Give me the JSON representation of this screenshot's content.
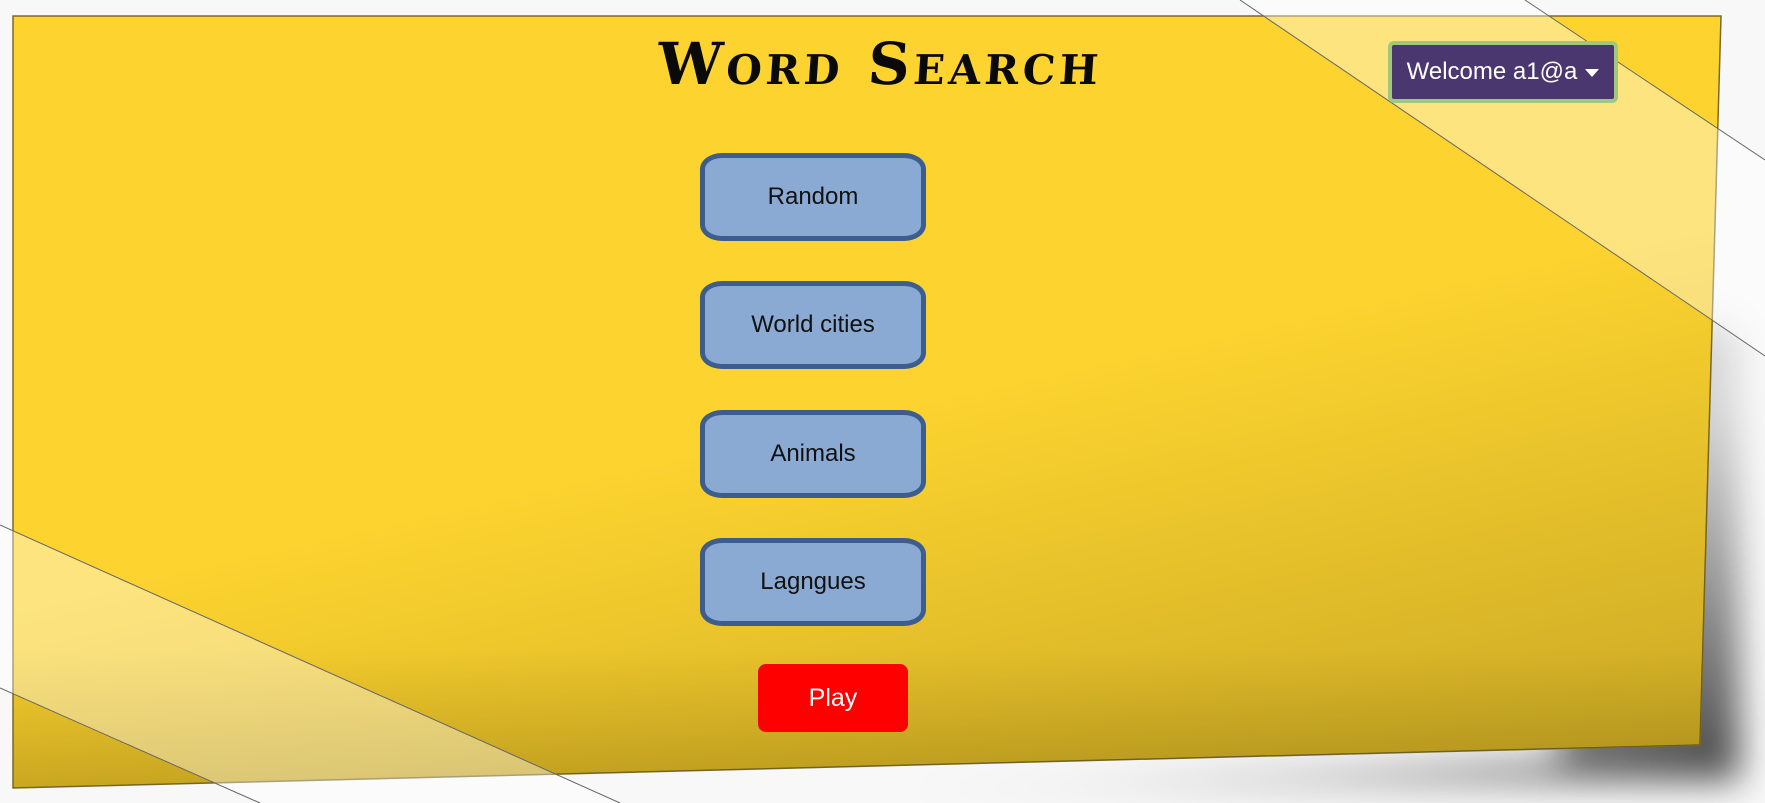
{
  "header": {
    "title": "Word Search",
    "user_menu_label": "Welcome a1@a"
  },
  "categories": [
    {
      "label": "Random"
    },
    {
      "label": "World cities"
    },
    {
      "label": "Animals"
    },
    {
      "label": "Lagngues"
    }
  ],
  "actions": {
    "play_label": "Play"
  },
  "colors": {
    "note": "#fdd42f",
    "category_fill": "#8aaad4",
    "category_border": "#3d5e8c",
    "play": "#ff0000",
    "user_menu": "#4b3770",
    "user_menu_border": "#9fc87e"
  },
  "icons": {
    "user_menu_caret": "caret-down-icon"
  }
}
